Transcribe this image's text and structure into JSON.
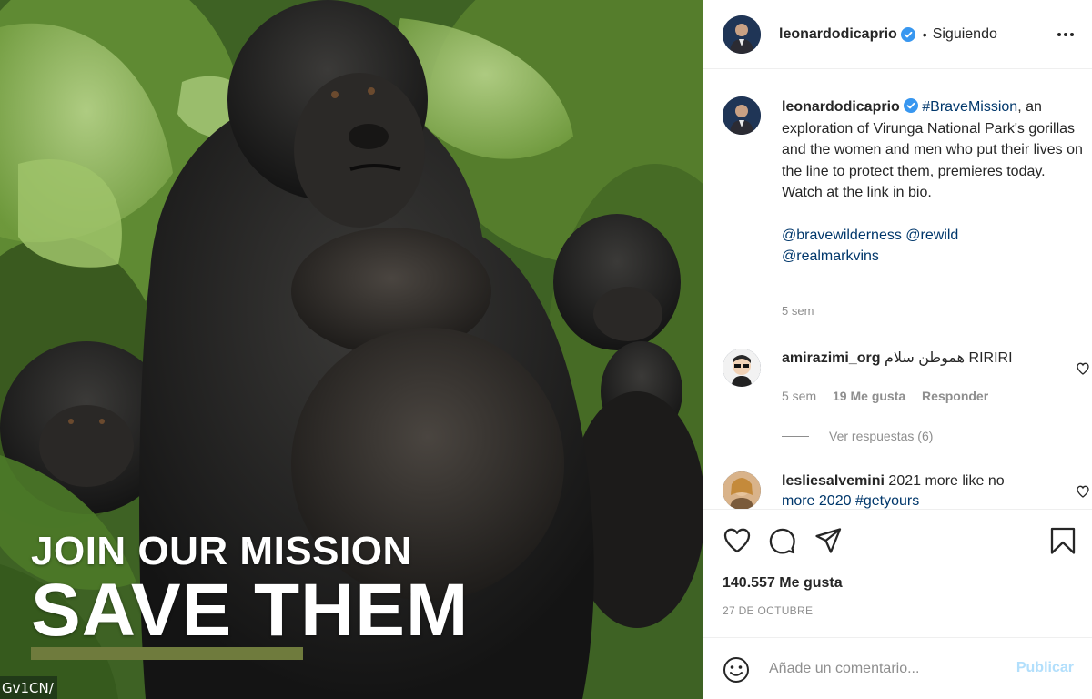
{
  "image": {
    "headline_line1": "JOIN OUR MISSION",
    "headline_line2": "SAVE THEM",
    "corner_tag": "Gv1CN/",
    "accent_bar_color": "#6f7b3d"
  },
  "header": {
    "username": "leonardodicaprio",
    "verified_icon": "verified-badge-icon",
    "separator": "•",
    "follow_status": "Siguiendo",
    "more_icon": "more-options-icon"
  },
  "caption": {
    "username": "leonardodicaprio",
    "hashtag": "#BraveMission",
    "text": ", an exploration of Virunga National Park's gorillas and the women and men who put their lives on the line to protect them, premieres today. Watch at the link in bio.",
    "mentions_line1": "@bravewilderness @rewild",
    "mentions_line2": "@realmarkvins",
    "time": "5 sem"
  },
  "comments": [
    {
      "username": "amirazimi_org",
      "text": "هموطن سلام RIRIRI",
      "time": "5 sem",
      "likes": "19 Me gusta",
      "reply": "Responder"
    },
    {
      "username": "lesliesalvemini",
      "text": "2021 more like no",
      "text_cut": "more 2020 #getyours"
    }
  ],
  "replies_label": "Ver respuestas (6)",
  "actions": {
    "like_icon": "heart-icon",
    "comment_icon": "comment-icon",
    "share_icon": "share-icon",
    "save_icon": "bookmark-icon"
  },
  "likes_count": "140.557 Me gusta",
  "date": "27 DE OCTUBRE",
  "comment_box": {
    "placeholder": "Añade un comentario...",
    "post_label": "Publicar",
    "emoji_icon": "emoji-icon"
  },
  "colors": {
    "link": "#00376b",
    "verified": "#3897f0",
    "post_disabled": "#b2dffc",
    "muted": "#8e8e8e"
  }
}
